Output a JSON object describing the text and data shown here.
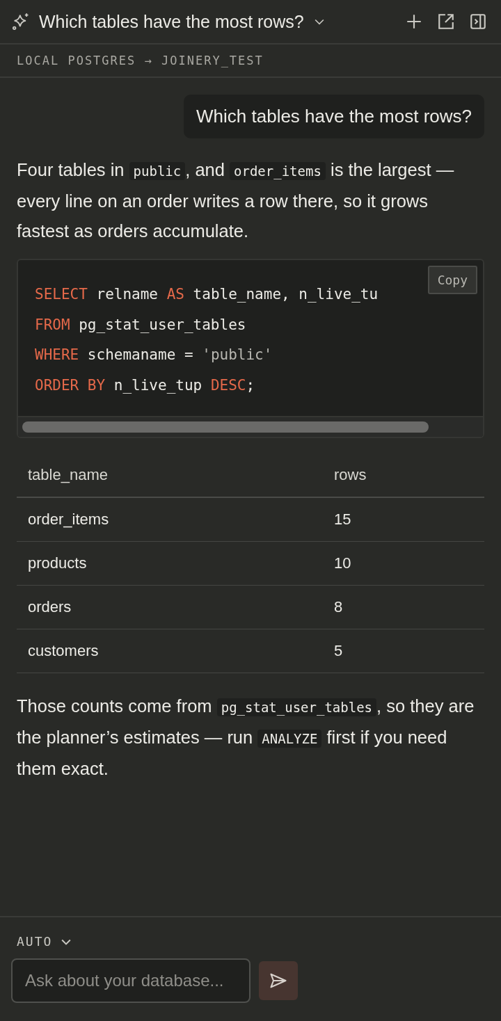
{
  "header": {
    "title": "Which tables have the most rows?"
  },
  "connection": "LOCAL POSTGRES → JOINERY_TEST",
  "user_message": "Which tables have the most rows?",
  "intro": [
    {
      "kind": "text",
      "text": "Four tables in "
    },
    {
      "kind": "code",
      "text": "public"
    },
    {
      "kind": "text",
      "text": ", and "
    },
    {
      "kind": "code",
      "text": "order_items"
    },
    {
      "kind": "text",
      "text": " is the largest — every line on an order writes a row there, so it grows fastest as orders accumulate."
    }
  ],
  "code_block": {
    "copy_label": "Copy",
    "lines": [
      [
        {
          "kind": "keyword",
          "text": "SELECT"
        },
        {
          "kind": "plain",
          "text": " relname "
        },
        {
          "kind": "keyword",
          "text": "AS"
        },
        {
          "kind": "plain",
          "text": " table_name, n_live_tu"
        }
      ],
      [
        {
          "kind": "keyword",
          "text": "FROM"
        },
        {
          "kind": "plain",
          "text": " pg_stat_user_tables"
        }
      ],
      [
        {
          "kind": "keyword",
          "text": "WHERE"
        },
        {
          "kind": "plain",
          "text": " schemaname = "
        },
        {
          "kind": "string",
          "text": "'public'"
        }
      ],
      [
        {
          "kind": "keyword",
          "text": "ORDER BY"
        },
        {
          "kind": "plain",
          "text": " n_live_tup "
        },
        {
          "kind": "keyword",
          "text": "DESC"
        },
        {
          "kind": "plain",
          "text": ";"
        }
      ]
    ]
  },
  "table": {
    "columns": [
      "table_name",
      "rows"
    ],
    "rows": [
      [
        "order_items",
        "15"
      ],
      [
        "products",
        "10"
      ],
      [
        "orders",
        "8"
      ],
      [
        "customers",
        "5"
      ]
    ]
  },
  "outro": [
    {
      "kind": "text",
      "text": "Those counts come from "
    },
    {
      "kind": "code",
      "text": "pg_stat_user_tables"
    },
    {
      "kind": "text",
      "text": ", so they are the planner’s estimates — run "
    },
    {
      "kind": "code",
      "text": "ANALYZE"
    },
    {
      "kind": "text",
      "text": " first if you need them exact."
    }
  ],
  "mode": "AUTO",
  "input": {
    "placeholder": "Ask about your database..."
  }
}
